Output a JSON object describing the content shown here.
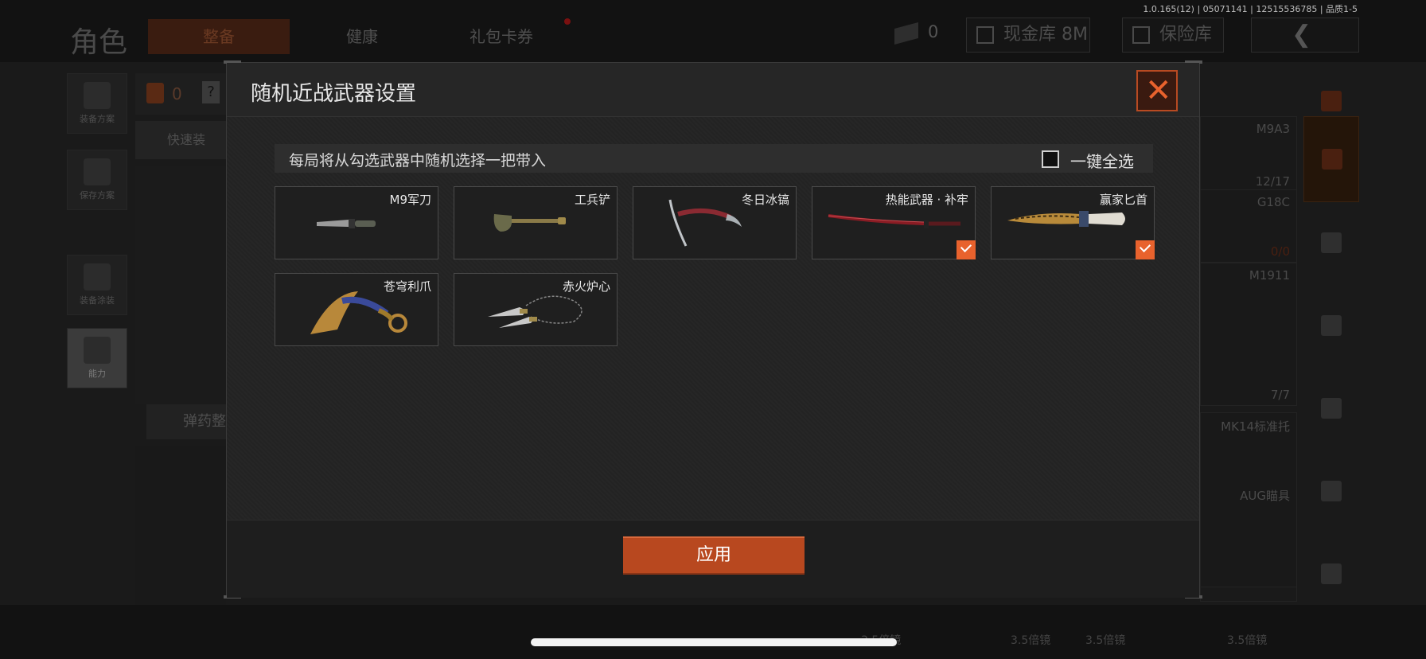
{
  "version_text": "1.0.165(12) | 05071141 | 12515536785 | 品质1-5",
  "header": {
    "title": "角色",
    "tabs": [
      {
        "label": "整备"
      },
      {
        "label": "健康"
      },
      {
        "label": "礼包卡券"
      }
    ],
    "cash_count": "0",
    "vault_label": "现金库 8M",
    "insurance_label": "保险库"
  },
  "left_sidebar": {
    "items": [
      {
        "label": "装备方案"
      },
      {
        "label": "保存方案"
      },
      {
        "label": "装备涂装"
      },
      {
        "label": "能力"
      }
    ],
    "counter": "0",
    "quick_equip": "快速装",
    "ammo_sort": "弹药整"
  },
  "right_slots": [
    {
      "label": "M9A3",
      "sub": "12/17"
    },
    {
      "label": "G18C",
      "sub": "0/0"
    },
    {
      "label": "M1911",
      "sub": "7/7"
    },
    {
      "label": "MK14标准托",
      "sub": ""
    },
    {
      "label": "AUG瞄具",
      "sub": ""
    }
  ],
  "bottom_labels": [
    "3.5倍镜",
    "3.5倍镜",
    "3.5倍镜",
    "3.5倍镜"
  ],
  "modal": {
    "title": "随机近战武器设置",
    "info_text": "每局将从勾选武器中随机选择一把带入",
    "select_all_label": "一键全选",
    "apply_label": "应用",
    "weapons": [
      {
        "name": "M9军刀",
        "checked": false
      },
      {
        "name": "工兵铲",
        "checked": false
      },
      {
        "name": "冬日冰镐",
        "checked": false
      },
      {
        "name": "热能武器 · 补牢",
        "checked": true
      },
      {
        "name": "赢家匕首",
        "checked": true
      },
      {
        "name": "苍穹利爪",
        "checked": false
      },
      {
        "name": "赤火炉心",
        "checked": false
      }
    ]
  },
  "colors": {
    "accent": "#e8622d",
    "apply_button": "#b8481f"
  }
}
